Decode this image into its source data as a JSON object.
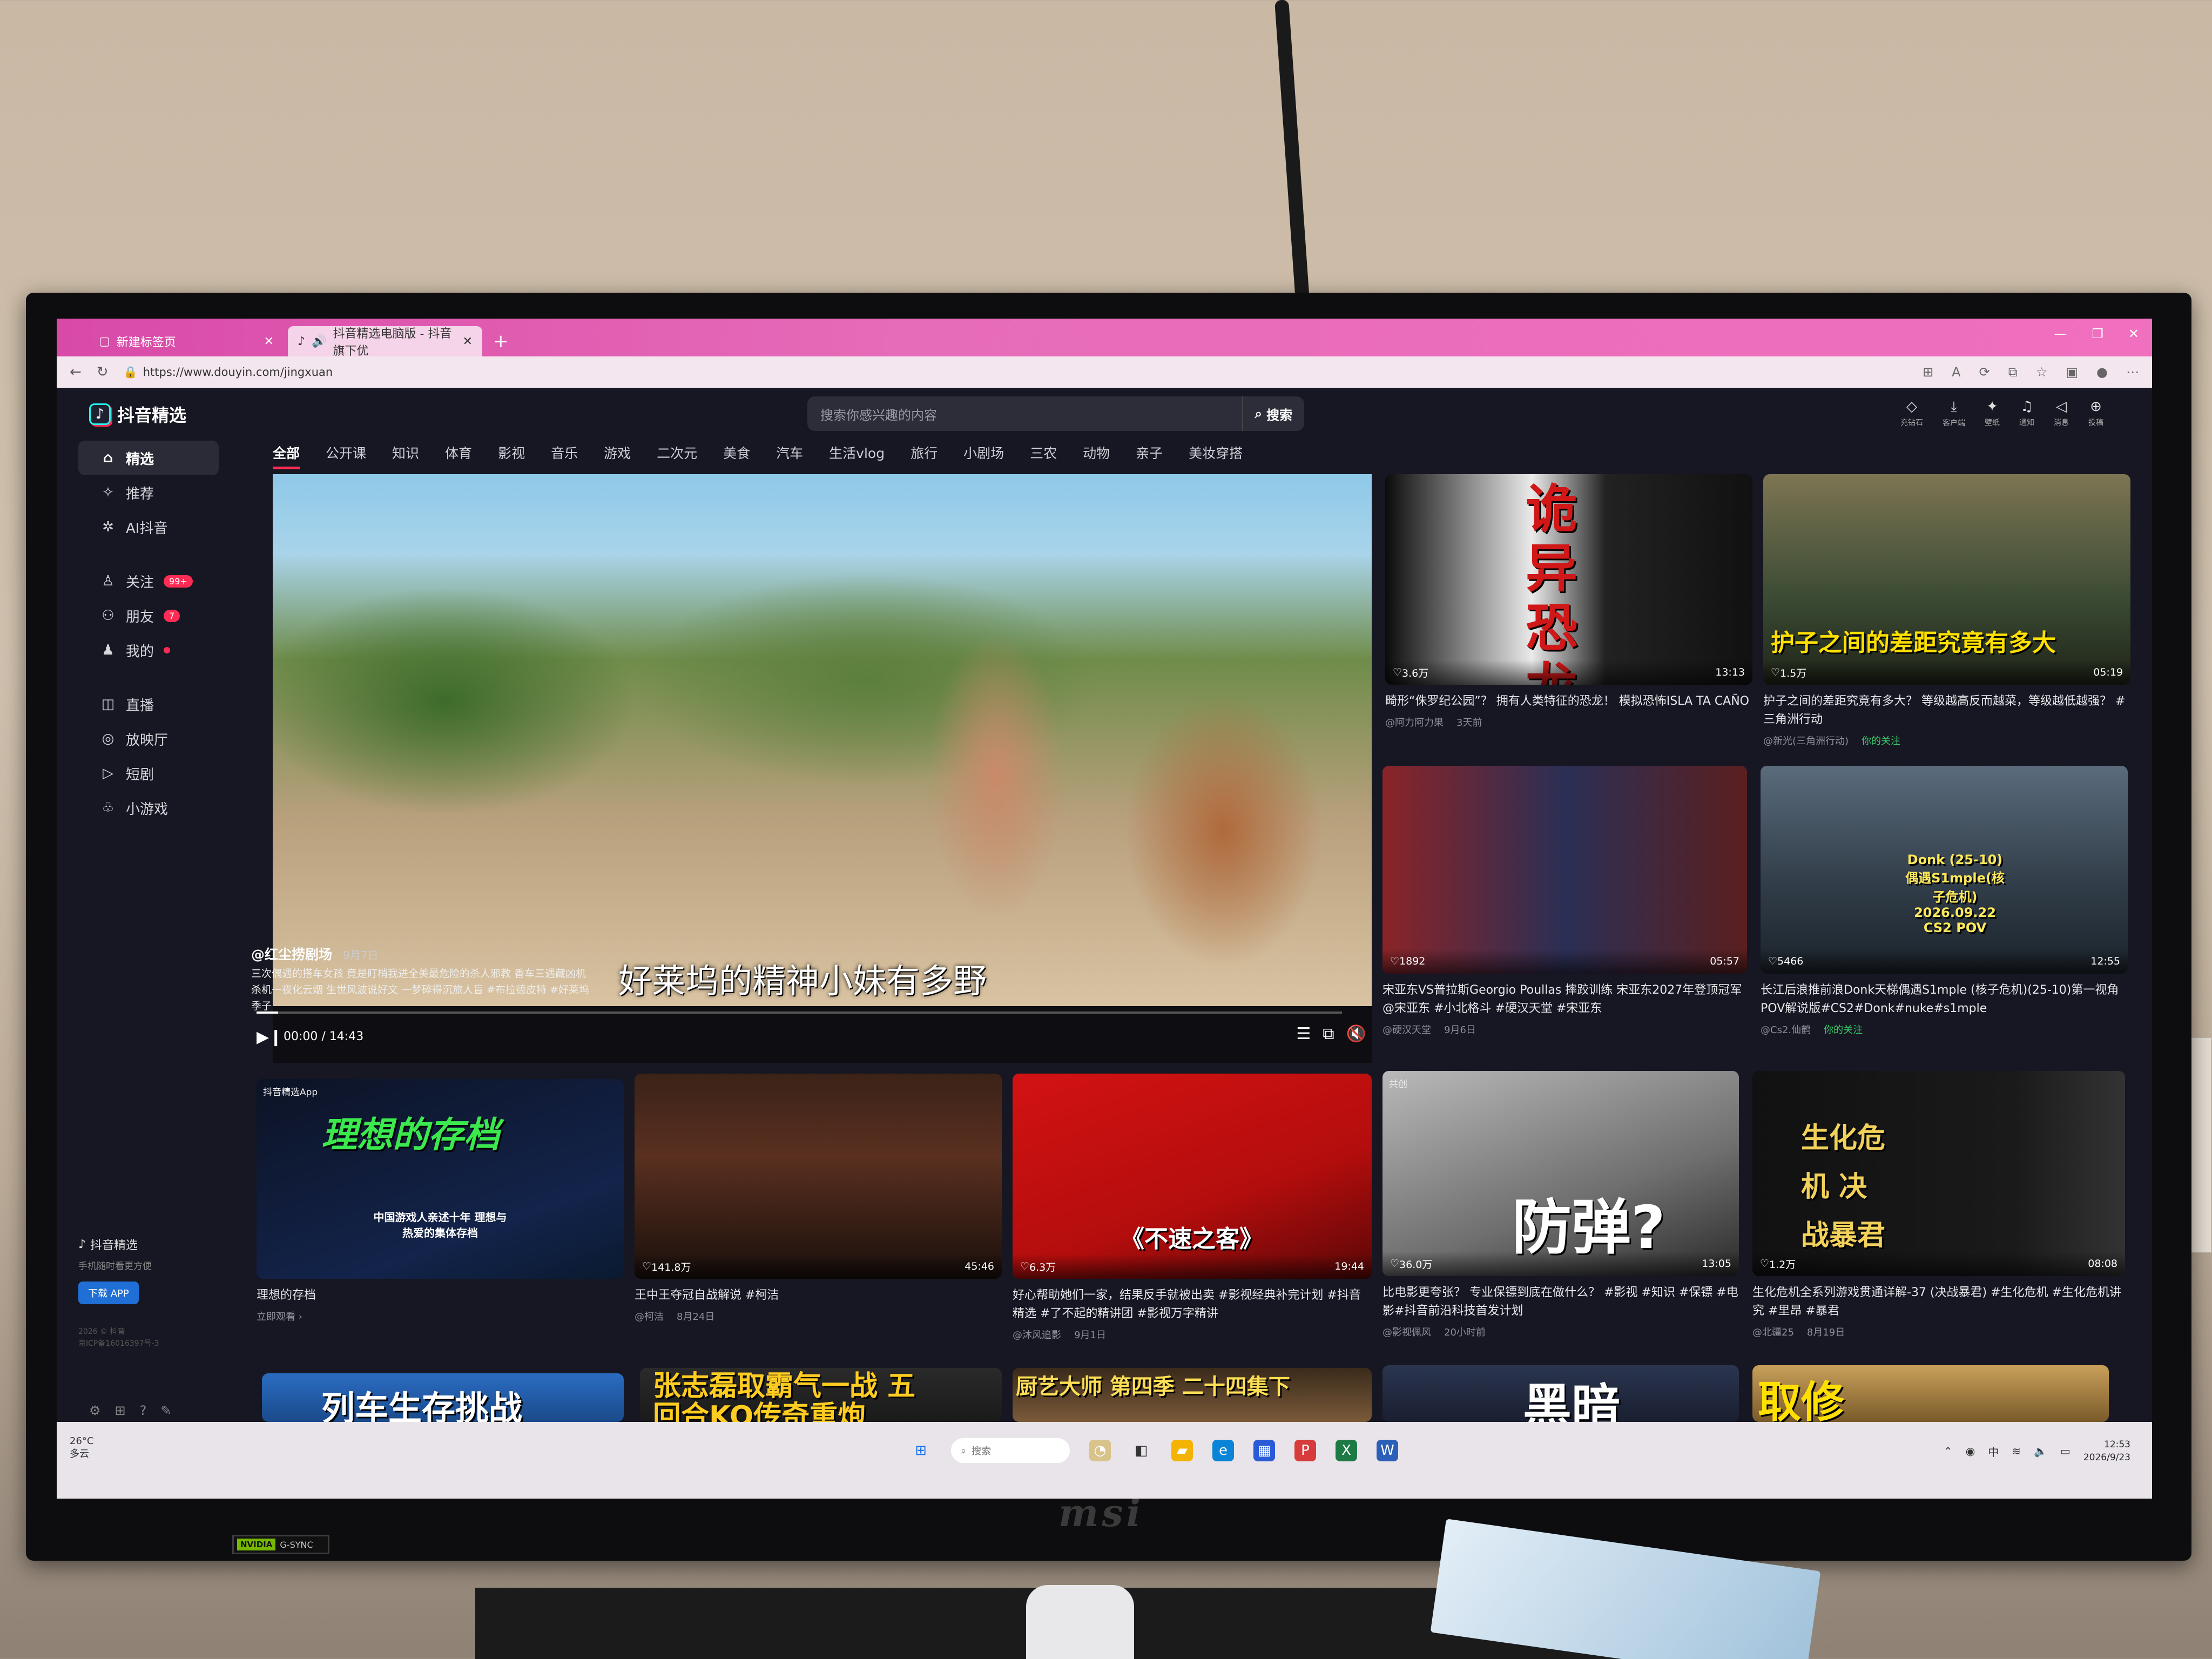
{
  "browser": {
    "tabs": [
      {
        "label": "新建标签页",
        "active": false
      },
      {
        "label": "抖音精选电脑版 - 抖音旗下优",
        "active": true
      }
    ],
    "url": "https://www.douyin.com/jingxuan"
  },
  "header": {
    "logo": "抖音精选",
    "search_placeholder": "搜索你感兴趣的内容",
    "search_button": "搜索",
    "icons": [
      {
        "icon": "diamond-icon",
        "label": "充钻石"
      },
      {
        "icon": "download-icon",
        "label": "客户端"
      },
      {
        "icon": "wallpaper-icon",
        "label": "壁纸"
      },
      {
        "icon": "bell-icon",
        "label": "通知"
      },
      {
        "icon": "message-icon",
        "label": "消息"
      },
      {
        "icon": "upload-icon",
        "label": "投稿"
      }
    ]
  },
  "sidebar": {
    "items": [
      {
        "label": "精选",
        "icon": "home-icon",
        "active": true
      },
      {
        "label": "推荐",
        "icon": "sparkle-icon"
      },
      {
        "label": "AI抖音",
        "icon": "ai-icon"
      },
      {
        "label": "关注",
        "icon": "follow-icon",
        "badge": "99+"
      },
      {
        "label": "朋友",
        "icon": "friends-icon",
        "badge": "7"
      },
      {
        "label": "我的",
        "icon": "user-icon",
        "dot": true
      },
      {
        "label": "直播",
        "icon": "live-icon"
      },
      {
        "label": "放映厅",
        "icon": "theater-icon"
      },
      {
        "label": "短剧",
        "icon": "drama-icon"
      },
      {
        "label": "小游戏",
        "icon": "game-icon"
      }
    ],
    "footer": {
      "title": "抖音精选",
      "subtitle": "手机随时看更方便",
      "download": "下载 APP",
      "copyright_1": "2026 © 抖音",
      "copyright_2": "京ICP备16016397号-3"
    }
  },
  "categories": [
    "全部",
    "公开课",
    "知识",
    "体育",
    "影视",
    "音乐",
    "游戏",
    "二次元",
    "美食",
    "汽车",
    "生活vlog",
    "旅行",
    "小剧场",
    "三农",
    "动物",
    "亲子",
    "美妆穿搭"
  ],
  "hero": {
    "author": "@红尘捞剧场",
    "date": "9月7日",
    "desc_1": "三次偶遇的搭车女孩 竟是盯梢我进全美最危险的杀人邪教 香车三遇藏凶机",
    "desc_2": "杀机一夜化云烟 生世风波说好文 一梦碎得沉旅人盲 #布拉德皮特 #好莱坞",
    "desc_3": "季子",
    "subtitle": "好莱坞的精神小妹有多野",
    "time": "00:00 / 14:43",
    "progress": 0.02
  },
  "grid": [
    {
      "id": "c1",
      "likes": "3.6万",
      "duration": "13:13",
      "big": "诡异恐龙",
      "title": "畸形“侏罗纪公园”？ 拥有人类特征的恐龙！ 模拟恐怖ISLA TA CAÑO",
      "author": "@阿力阿力果",
      "time": "3天前"
    },
    {
      "id": "c2",
      "likes": "1.5万",
      "duration": "05:19",
      "big": "护子之间的差距究竟有多大",
      "title": "护子之间的差距究竟有多大？ 等级越高反而越菜，等级越低越强？ #三角洲行动",
      "author": "@新光(三角洲行动)",
      "time": "你的关注"
    },
    {
      "id": "c3",
      "likes": "1892",
      "duration": "05:57",
      "big": "",
      "title": "宋亚东VS普拉斯Georgio Poullas 摔跤训练 宋亚东2027年登顶冠军@宋亚东 #小北格斗 #硬汉天堂 #宋亚东",
      "author": "@硬汉天堂",
      "time": "9月6日"
    },
    {
      "id": "c4",
      "likes": "5466",
      "duration": "12:55",
      "big": "Donk (25-10) 偶遇S1mple(核子危机) 2026.09.22 CS2 POV",
      "title": "长江后浪推前浪Donk天梯偶遇S1mple (核子危机)(25-10)第一视角POV解说版#CS2#Donk#nuke#s1mple",
      "author": "@Cs2.仙鹤",
      "time": "你的关注"
    },
    {
      "id": "c5",
      "likes": "",
      "duration": "",
      "big": "理想的存档",
      "title": "理想的存档",
      "author": "立即观看 ›",
      "time": "",
      "tag": "抖音精选App",
      "sub": "中国游戏人亲述十年 理想与热爱的集体存档"
    },
    {
      "id": "c6",
      "likes": "141.8万",
      "duration": "45:46",
      "big": "",
      "title": "王中王夺冠自战解说 #柯洁",
      "author": "@柯洁",
      "time": "8月24日"
    },
    {
      "id": "c7",
      "likes": "6.3万",
      "duration": "19:44",
      "big": "《不速之客》",
      "title": "好心帮助她们一家，结果反手就被出卖 #影视经典补完计划 #抖音精选 #了不起的精讲团 #影视万字精讲",
      "author": "@沐风追影",
      "time": "9月1日"
    },
    {
      "id": "c8",
      "likes": "36.0万",
      "duration": "13:05",
      "big": "防弹?",
      "title": "比电影更夸张？ 专业保镖到底在做什么？ #影视 #知识 #保镖 #电影#抖音前沿科技首发计划",
      "author": "@影视佩风",
      "time": "20小时前",
      "tag": "共创"
    },
    {
      "id": "c9",
      "likes": "1.2万",
      "duration": "08:08",
      "big": "生化危机 决战暴君",
      "title": "生化危机全系列游戏贯通详解-37 (决战暴君) #生化危机 #生化危机讲究 #里昂 #暴君",
      "author": "@北疆25",
      "time": "8月19日"
    },
    {
      "id": "c10",
      "big": "列车生存挑战"
    },
    {
      "id": "c11",
      "big": "张志磊取霸气一战 五回合KO传奇重炮"
    },
    {
      "id": "c12",
      "big": "厨艺大师 第四季 二十四集下"
    },
    {
      "id": "c13",
      "big": "黑暗"
    },
    {
      "id": "c14",
      "big": "取修"
    }
  ],
  "taskbar": {
    "weather_temp": "26°C",
    "weather_desc": "多云",
    "search": "搜索",
    "ime": "中",
    "time": "12:53",
    "date": "2026/9/23"
  },
  "monitor": {
    "brand": "msi",
    "sticker": "G-SYNC",
    "sticker_brand": "NVIDIA"
  },
  "colors": {
    "accent": "#fe2c55",
    "page_bg": "#161722",
    "tab_bar": "#e66bb8",
    "follow_green": "#3cc86a"
  }
}
